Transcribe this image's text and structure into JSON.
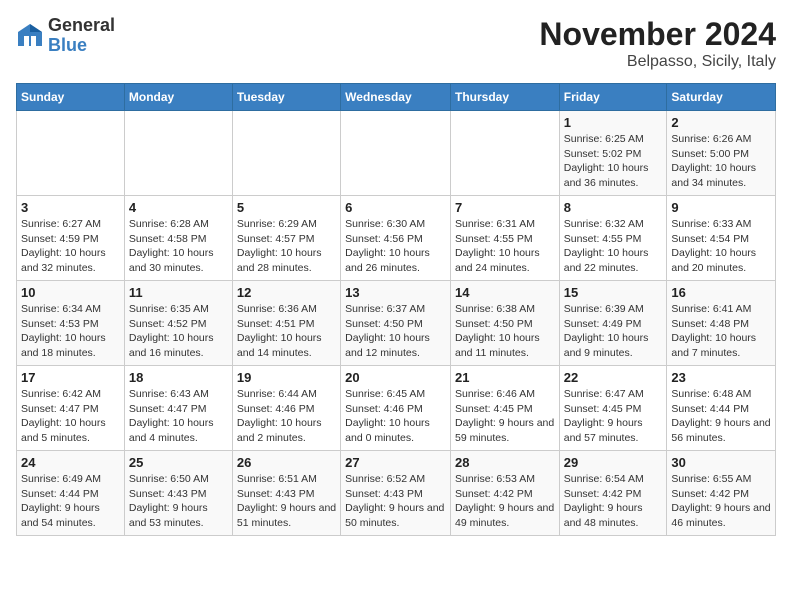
{
  "header": {
    "logo": {
      "general": "General",
      "blue": "Blue"
    },
    "title": "November 2024",
    "location": "Belpasso, Sicily, Italy"
  },
  "weekdays": [
    "Sunday",
    "Monday",
    "Tuesday",
    "Wednesday",
    "Thursday",
    "Friday",
    "Saturday"
  ],
  "weeks": [
    [
      {
        "day": "",
        "info": ""
      },
      {
        "day": "",
        "info": ""
      },
      {
        "day": "",
        "info": ""
      },
      {
        "day": "",
        "info": ""
      },
      {
        "day": "",
        "info": ""
      },
      {
        "day": "1",
        "info": "Sunrise: 6:25 AM\nSunset: 5:02 PM\nDaylight: 10 hours and 36 minutes."
      },
      {
        "day": "2",
        "info": "Sunrise: 6:26 AM\nSunset: 5:00 PM\nDaylight: 10 hours and 34 minutes."
      }
    ],
    [
      {
        "day": "3",
        "info": "Sunrise: 6:27 AM\nSunset: 4:59 PM\nDaylight: 10 hours and 32 minutes."
      },
      {
        "day": "4",
        "info": "Sunrise: 6:28 AM\nSunset: 4:58 PM\nDaylight: 10 hours and 30 minutes."
      },
      {
        "day": "5",
        "info": "Sunrise: 6:29 AM\nSunset: 4:57 PM\nDaylight: 10 hours and 28 minutes."
      },
      {
        "day": "6",
        "info": "Sunrise: 6:30 AM\nSunset: 4:56 PM\nDaylight: 10 hours and 26 minutes."
      },
      {
        "day": "7",
        "info": "Sunrise: 6:31 AM\nSunset: 4:55 PM\nDaylight: 10 hours and 24 minutes."
      },
      {
        "day": "8",
        "info": "Sunrise: 6:32 AM\nSunset: 4:55 PM\nDaylight: 10 hours and 22 minutes."
      },
      {
        "day": "9",
        "info": "Sunrise: 6:33 AM\nSunset: 4:54 PM\nDaylight: 10 hours and 20 minutes."
      }
    ],
    [
      {
        "day": "10",
        "info": "Sunrise: 6:34 AM\nSunset: 4:53 PM\nDaylight: 10 hours and 18 minutes."
      },
      {
        "day": "11",
        "info": "Sunrise: 6:35 AM\nSunset: 4:52 PM\nDaylight: 10 hours and 16 minutes."
      },
      {
        "day": "12",
        "info": "Sunrise: 6:36 AM\nSunset: 4:51 PM\nDaylight: 10 hours and 14 minutes."
      },
      {
        "day": "13",
        "info": "Sunrise: 6:37 AM\nSunset: 4:50 PM\nDaylight: 10 hours and 12 minutes."
      },
      {
        "day": "14",
        "info": "Sunrise: 6:38 AM\nSunset: 4:50 PM\nDaylight: 10 hours and 11 minutes."
      },
      {
        "day": "15",
        "info": "Sunrise: 6:39 AM\nSunset: 4:49 PM\nDaylight: 10 hours and 9 minutes."
      },
      {
        "day": "16",
        "info": "Sunrise: 6:41 AM\nSunset: 4:48 PM\nDaylight: 10 hours and 7 minutes."
      }
    ],
    [
      {
        "day": "17",
        "info": "Sunrise: 6:42 AM\nSunset: 4:47 PM\nDaylight: 10 hours and 5 minutes."
      },
      {
        "day": "18",
        "info": "Sunrise: 6:43 AM\nSunset: 4:47 PM\nDaylight: 10 hours and 4 minutes."
      },
      {
        "day": "19",
        "info": "Sunrise: 6:44 AM\nSunset: 4:46 PM\nDaylight: 10 hours and 2 minutes."
      },
      {
        "day": "20",
        "info": "Sunrise: 6:45 AM\nSunset: 4:46 PM\nDaylight: 10 hours and 0 minutes."
      },
      {
        "day": "21",
        "info": "Sunrise: 6:46 AM\nSunset: 4:45 PM\nDaylight: 9 hours and 59 minutes."
      },
      {
        "day": "22",
        "info": "Sunrise: 6:47 AM\nSunset: 4:45 PM\nDaylight: 9 hours and 57 minutes."
      },
      {
        "day": "23",
        "info": "Sunrise: 6:48 AM\nSunset: 4:44 PM\nDaylight: 9 hours and 56 minutes."
      }
    ],
    [
      {
        "day": "24",
        "info": "Sunrise: 6:49 AM\nSunset: 4:44 PM\nDaylight: 9 hours and 54 minutes."
      },
      {
        "day": "25",
        "info": "Sunrise: 6:50 AM\nSunset: 4:43 PM\nDaylight: 9 hours and 53 minutes."
      },
      {
        "day": "26",
        "info": "Sunrise: 6:51 AM\nSunset: 4:43 PM\nDaylight: 9 hours and 51 minutes."
      },
      {
        "day": "27",
        "info": "Sunrise: 6:52 AM\nSunset: 4:43 PM\nDaylight: 9 hours and 50 minutes."
      },
      {
        "day": "28",
        "info": "Sunrise: 6:53 AM\nSunset: 4:42 PM\nDaylight: 9 hours and 49 minutes."
      },
      {
        "day": "29",
        "info": "Sunrise: 6:54 AM\nSunset: 4:42 PM\nDaylight: 9 hours and 48 minutes."
      },
      {
        "day": "30",
        "info": "Sunrise: 6:55 AM\nSunset: 4:42 PM\nDaylight: 9 hours and 46 minutes."
      }
    ]
  ]
}
